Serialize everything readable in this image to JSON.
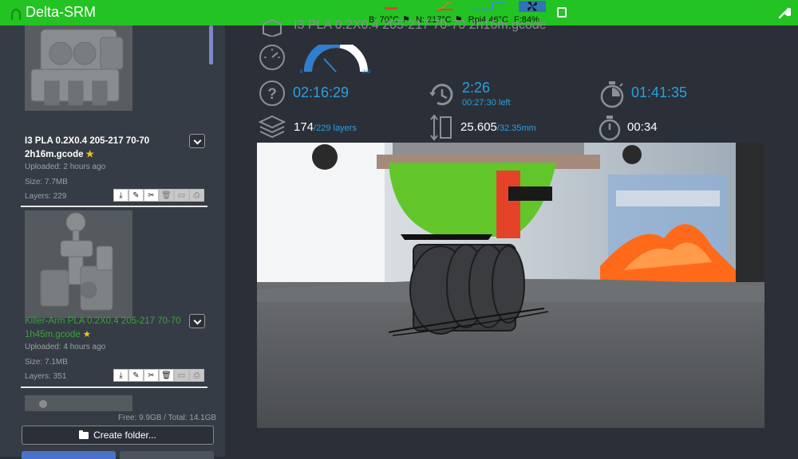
{
  "app": {
    "title": "Delta-SRM"
  },
  "status": {
    "bed": "B: 70°C",
    "nozzle": "N: 217°C",
    "rpi": "Rpi4 46°C",
    "fan": "F:84%"
  },
  "files": [
    {
      "name": "I3 PLA 0.2X0.4 205-217 70-70 2h16m.gcode",
      "star": "★",
      "uploaded": "Uploaded: 2 hours ago",
      "size": "Size: 7.7MB",
      "layers": "Layers: 229",
      "selected": true
    },
    {
      "name": "Killer-Arm PLA 0.2X0.4 205-217 70-70 1h45m.gcode",
      "star": "★",
      "uploaded": "Uploaded: 4 hours ago",
      "size": "Size: 7.1MB",
      "layers": "Layers: 351",
      "selected": false
    }
  ],
  "storage": {
    "free": "Free: 9.9GB / Total: 14.1GB"
  },
  "buttons": {
    "create_folder": "Create folder..."
  },
  "job": {
    "file_name_partial": "I3 PLA 0.2X0.4 205-217 70-70 2h16m.gcode",
    "speed_gauge": {
      "min": "0",
      "max": "200",
      "value_fraction": 0.55
    },
    "estimated_total": "02:16:29",
    "elapsed": "2:26",
    "elapsed_left": "00:27:30 left",
    "remaining": "01:41:35",
    "layer_current": "174",
    "layer_total": "/229 layers",
    "height_current": "25.605",
    "height_total": "/32.35mm",
    "layer_time": "00:34"
  },
  "colors": {
    "topbar": "#22c322",
    "accent": "#2a9fe0",
    "sidebar": "#363c45",
    "main": "#2b3038"
  }
}
